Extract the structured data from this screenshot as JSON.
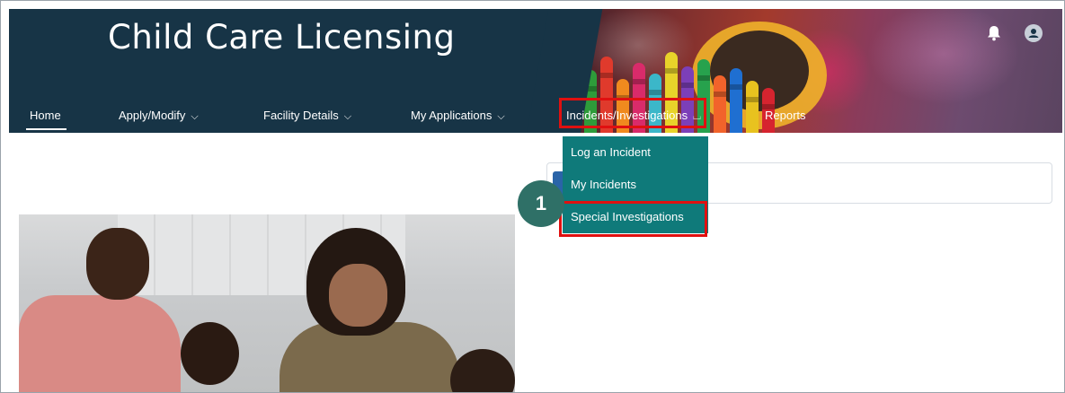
{
  "header": {
    "title": "Child Care Licensing",
    "bell_icon": "bell-icon",
    "avatar_icon": "user-avatar-icon",
    "background_color": "#173446"
  },
  "nav": {
    "items": [
      {
        "label": "Home",
        "chevron": ""
      },
      {
        "label": "Apply/Modify",
        "chevron": "down"
      },
      {
        "label": "Facility Details",
        "chevron": "down"
      },
      {
        "label": "My Applications",
        "chevron": "down"
      },
      {
        "label": "Incidents/Investigations",
        "chevron": "up"
      },
      {
        "label": "Reports",
        "chevron": ""
      }
    ],
    "active": "Home",
    "open_menu": "Incidents/Investigations"
  },
  "dropdown": {
    "items": [
      {
        "label": "Log an Incident"
      },
      {
        "label": "My Incidents"
      },
      {
        "label": "Special Investigations"
      }
    ],
    "background_color": "#0f7a7a"
  },
  "callout": {
    "number": "1",
    "color": "#2f7067"
  },
  "highlight_color": "#e01010"
}
